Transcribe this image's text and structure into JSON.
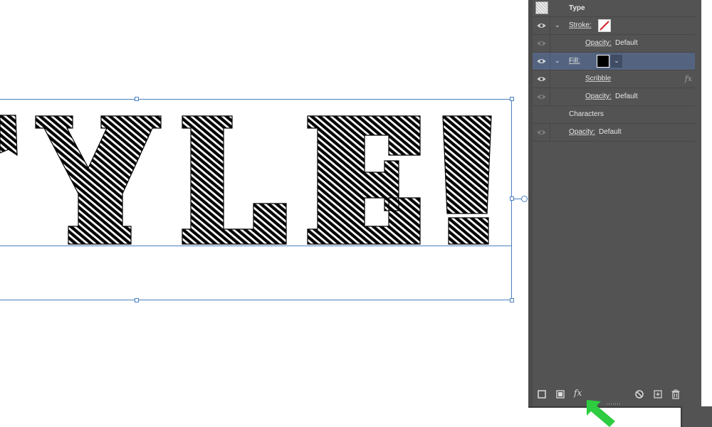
{
  "canvas": {
    "artwork_text": "STYLE!",
    "artwork_style": "scribble-hatched black letters"
  },
  "appearance_panel": {
    "header": {
      "label": "Type"
    },
    "rows": [
      {
        "id": "stroke",
        "label": "Stroke:",
        "swatch": "none (red slash)",
        "expanded": true,
        "visible": true
      },
      {
        "id": "stroke-opacity",
        "label": "Opacity:",
        "value": "Default"
      },
      {
        "id": "fill",
        "label": "Fill:",
        "swatch_color": "#000000",
        "expanded": true,
        "visible": true,
        "selected": true
      },
      {
        "id": "scribble",
        "label": "Scribble",
        "effect": "fx"
      },
      {
        "id": "fill-opacity",
        "label": "Opacity:",
        "value": "Default"
      },
      {
        "id": "characters",
        "label": "Characters"
      },
      {
        "id": "opacity",
        "label": "Opacity:",
        "value": "Default"
      }
    ],
    "toolbar": {
      "add_stroke": "add-new-stroke-icon",
      "add_fill": "add-new-fill-icon",
      "add_effect": "fx",
      "clear": "clear-appearance-icon",
      "duplicate": "duplicate-item-icon",
      "delete": "trash-icon"
    }
  },
  "colors": {
    "panel_bg": "#535353",
    "selected_row": "#546480",
    "selection_blue": "#4a7fbf",
    "pointer_arrow": "#2ecc40"
  }
}
